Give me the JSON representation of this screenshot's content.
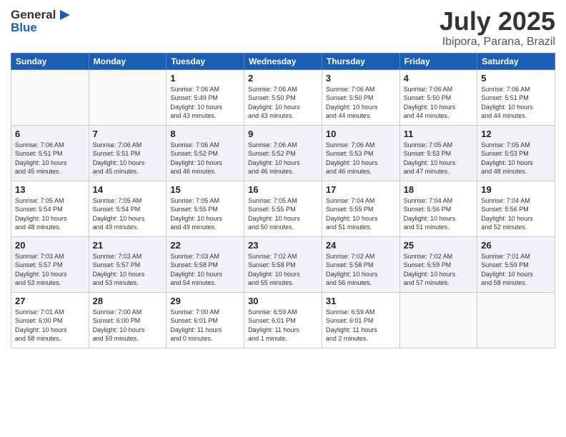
{
  "header": {
    "logo_general": "General",
    "logo_blue": "Blue",
    "month": "July 2025",
    "location": "Ibipora, Parana, Brazil"
  },
  "weekdays": [
    "Sunday",
    "Monday",
    "Tuesday",
    "Wednesday",
    "Thursday",
    "Friday",
    "Saturday"
  ],
  "weeks": [
    [
      {
        "day": "",
        "info": ""
      },
      {
        "day": "",
        "info": ""
      },
      {
        "day": "1",
        "info": "Sunrise: 7:06 AM\nSunset: 5:49 PM\nDaylight: 10 hours\nand 43 minutes."
      },
      {
        "day": "2",
        "info": "Sunrise: 7:06 AM\nSunset: 5:50 PM\nDaylight: 10 hours\nand 43 minutes."
      },
      {
        "day": "3",
        "info": "Sunrise: 7:06 AM\nSunset: 5:50 PM\nDaylight: 10 hours\nand 44 minutes."
      },
      {
        "day": "4",
        "info": "Sunrise: 7:06 AM\nSunset: 5:50 PM\nDaylight: 10 hours\nand 44 minutes."
      },
      {
        "day": "5",
        "info": "Sunrise: 7:06 AM\nSunset: 5:51 PM\nDaylight: 10 hours\nand 44 minutes."
      }
    ],
    [
      {
        "day": "6",
        "info": "Sunrise: 7:06 AM\nSunset: 5:51 PM\nDaylight: 10 hours\nand 45 minutes."
      },
      {
        "day": "7",
        "info": "Sunrise: 7:06 AM\nSunset: 5:51 PM\nDaylight: 10 hours\nand 45 minutes."
      },
      {
        "day": "8",
        "info": "Sunrise: 7:06 AM\nSunset: 5:52 PM\nDaylight: 10 hours\nand 46 minutes."
      },
      {
        "day": "9",
        "info": "Sunrise: 7:06 AM\nSunset: 5:52 PM\nDaylight: 10 hours\nand 46 minutes."
      },
      {
        "day": "10",
        "info": "Sunrise: 7:06 AM\nSunset: 5:53 PM\nDaylight: 10 hours\nand 46 minutes."
      },
      {
        "day": "11",
        "info": "Sunrise: 7:05 AM\nSunset: 5:53 PM\nDaylight: 10 hours\nand 47 minutes."
      },
      {
        "day": "12",
        "info": "Sunrise: 7:05 AM\nSunset: 5:53 PM\nDaylight: 10 hours\nand 48 minutes."
      }
    ],
    [
      {
        "day": "13",
        "info": "Sunrise: 7:05 AM\nSunset: 5:54 PM\nDaylight: 10 hours\nand 48 minutes."
      },
      {
        "day": "14",
        "info": "Sunrise: 7:05 AM\nSunset: 5:54 PM\nDaylight: 10 hours\nand 49 minutes."
      },
      {
        "day": "15",
        "info": "Sunrise: 7:05 AM\nSunset: 5:55 PM\nDaylight: 10 hours\nand 49 minutes."
      },
      {
        "day": "16",
        "info": "Sunrise: 7:05 AM\nSunset: 5:55 PM\nDaylight: 10 hours\nand 50 minutes."
      },
      {
        "day": "17",
        "info": "Sunrise: 7:04 AM\nSunset: 5:55 PM\nDaylight: 10 hours\nand 51 minutes."
      },
      {
        "day": "18",
        "info": "Sunrise: 7:04 AM\nSunset: 5:56 PM\nDaylight: 10 hours\nand 51 minutes."
      },
      {
        "day": "19",
        "info": "Sunrise: 7:04 AM\nSunset: 5:56 PM\nDaylight: 10 hours\nand 52 minutes."
      }
    ],
    [
      {
        "day": "20",
        "info": "Sunrise: 7:03 AM\nSunset: 5:57 PM\nDaylight: 10 hours\nand 53 minutes."
      },
      {
        "day": "21",
        "info": "Sunrise: 7:03 AM\nSunset: 5:57 PM\nDaylight: 10 hours\nand 53 minutes."
      },
      {
        "day": "22",
        "info": "Sunrise: 7:03 AM\nSunset: 5:58 PM\nDaylight: 10 hours\nand 54 minutes."
      },
      {
        "day": "23",
        "info": "Sunrise: 7:02 AM\nSunset: 5:58 PM\nDaylight: 10 hours\nand 55 minutes."
      },
      {
        "day": "24",
        "info": "Sunrise: 7:02 AM\nSunset: 5:58 PM\nDaylight: 10 hours\nand 56 minutes."
      },
      {
        "day": "25",
        "info": "Sunrise: 7:02 AM\nSunset: 5:59 PM\nDaylight: 10 hours\nand 57 minutes."
      },
      {
        "day": "26",
        "info": "Sunrise: 7:01 AM\nSunset: 5:59 PM\nDaylight: 10 hours\nand 58 minutes."
      }
    ],
    [
      {
        "day": "27",
        "info": "Sunrise: 7:01 AM\nSunset: 6:00 PM\nDaylight: 10 hours\nand 58 minutes."
      },
      {
        "day": "28",
        "info": "Sunrise: 7:00 AM\nSunset: 6:00 PM\nDaylight: 10 hours\nand 59 minutes."
      },
      {
        "day": "29",
        "info": "Sunrise: 7:00 AM\nSunset: 6:01 PM\nDaylight: 11 hours\nand 0 minutes."
      },
      {
        "day": "30",
        "info": "Sunrise: 6:59 AM\nSunset: 6:01 PM\nDaylight: 11 hours\nand 1 minute."
      },
      {
        "day": "31",
        "info": "Sunrise: 6:59 AM\nSunset: 6:01 PM\nDaylight: 11 hours\nand 2 minutes."
      },
      {
        "day": "",
        "info": ""
      },
      {
        "day": "",
        "info": ""
      }
    ]
  ]
}
